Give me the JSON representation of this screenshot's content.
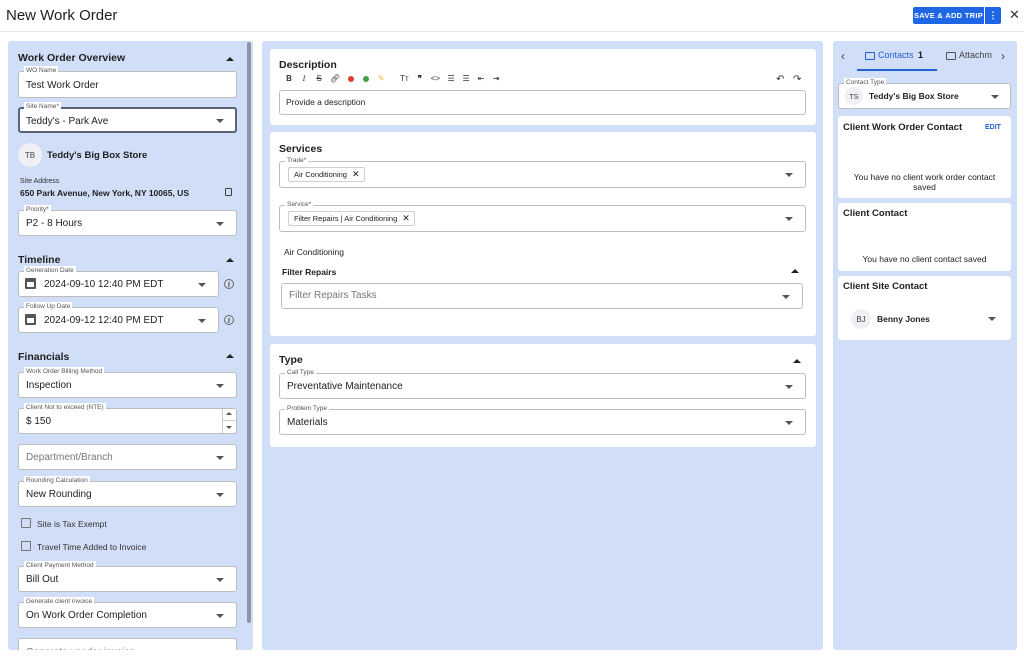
{
  "header": {
    "title": "New Work Order",
    "save_label": "SAVE & ADD TRIP",
    "more_label": "⋮",
    "close_label": "✕"
  },
  "overview": {
    "title": "Work Order Overview",
    "wo_name_label": "WO Name",
    "wo_name_value": "Test Work Order",
    "site_name_label": "Site Name*",
    "site_name_value": "Teddy's - Park Ave",
    "client_initials": "TB",
    "client_name": "Teddy's Big Box Store",
    "site_address_label": "Site Address",
    "site_address_value": "650 Park Avenue, New York, NY 10065, US",
    "priority_label": "Priority*",
    "priority_value": "P2 - 8 Hours"
  },
  "timeline": {
    "title": "Timeline",
    "generation_label": "Generation Date",
    "generation_value": "2024-09-10 12:40 PM EDT",
    "followup_label": "Follow Up Date",
    "followup_value": "2024-09-12 12:40 PM EDT"
  },
  "financials": {
    "title": "Financials",
    "billing_label": "Work Order Billing Method",
    "billing_value": "Inspection",
    "nte_label": "Client Not to exceed (NTE)",
    "nte_value": "$ 150",
    "department_placeholder": "Department/Branch",
    "rounding_label": "Rounding Calculation",
    "rounding_value": "New Rounding",
    "tax_exempt_label": "Site is Tax Exempt",
    "travel_time_label": "Travel Time Added to Invoice",
    "payment_label": "Client Payment Method",
    "payment_value": "Bill Out",
    "gen_invoice_label": "Generate client invoice",
    "gen_invoice_value": "On Work Order Completion",
    "vendor_invoice_partial": "Generate vendor invoice"
  },
  "description": {
    "title": "Description",
    "placeholder": "Provide a description",
    "toolbar": [
      "B",
      "I",
      "S",
      "link",
      "red",
      "green",
      "highlight",
      "Tт",
      "❞",
      "<>",
      "•≡",
      "1≡",
      "⇤",
      "⇥",
      "↶",
      "↷"
    ],
    "colors": {
      "red": "#e53935",
      "green": "#43a047",
      "highlight": "#f2b233"
    }
  },
  "services": {
    "title": "Services",
    "trade_label": "Trade*",
    "trade_chip": "Air Conditioning",
    "service_label": "Service*",
    "service_chip": "Filter Repairs | Air Conditioning",
    "trade_heading": "Air Conditioning",
    "service_heading": "Filter Repairs",
    "tasks_placeholder": "Filter Repairs Tasks"
  },
  "type": {
    "title": "Type",
    "call_type_label": "Call Type",
    "call_type_value": "Preventative Maintenance",
    "problem_type_label": "Problem Type",
    "problem_type_value": "Materials"
  },
  "contacts_panel": {
    "tab_contacts": "Contacts",
    "tab_contacts_count": "1",
    "tab_attach": "Attachm",
    "contact_type_label": "Contact Type",
    "contact_type_initials": "TS",
    "contact_type_value": "Teddy's Big Box Store",
    "client_wo_contact_title": "Client Work Order Contact",
    "edit_label": "EDIT",
    "no_wo_contact": "You have no client work order contact saved",
    "client_contact_title": "Client Contact",
    "no_client_contact": "You have no client contact saved",
    "site_contact_title": "Client Site Contact",
    "site_contact_initials": "BJ",
    "site_contact_name": "Benny Jones"
  },
  "colors": {
    "accent": "#1f66e5",
    "panel_bg": "#d1def7",
    "tab_active": "#2460d8"
  }
}
